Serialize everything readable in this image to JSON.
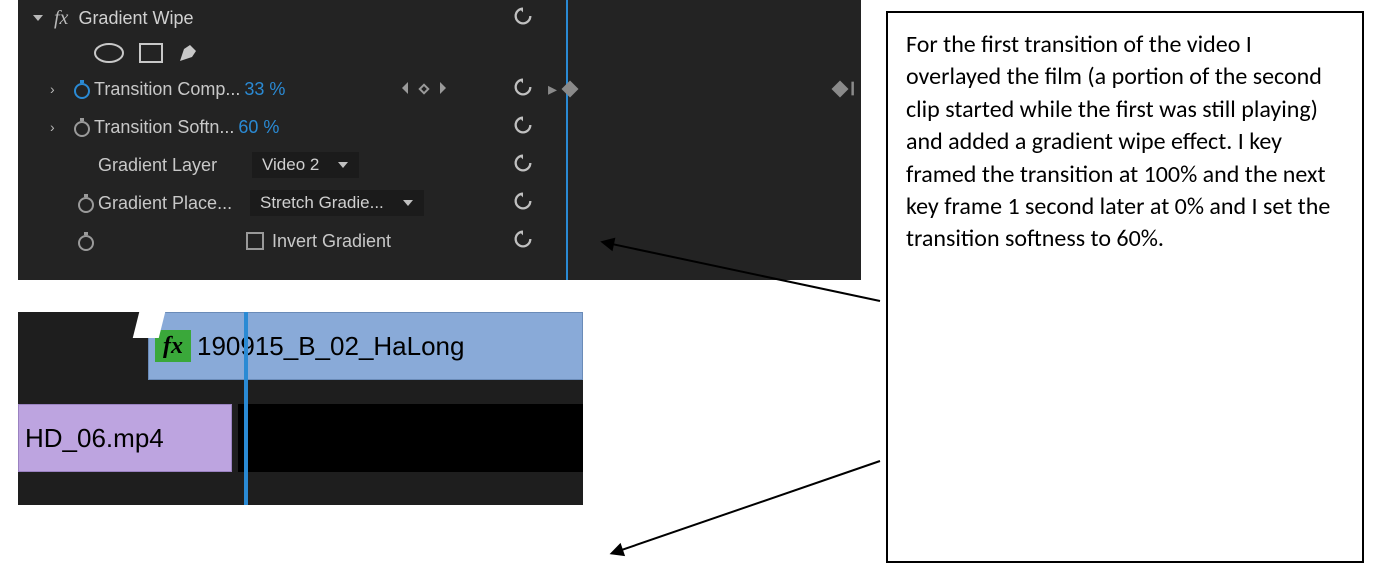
{
  "effects": {
    "name": "Gradient Wipe",
    "mask_shapes": [
      "ellipse",
      "rectangle",
      "pen"
    ],
    "props": {
      "transition_completion": {
        "label": "Transition Comp...",
        "value": "33 %",
        "animated": true
      },
      "transition_softness": {
        "label": "Transition Softn...",
        "value": "60 %",
        "animated": false
      },
      "gradient_layer": {
        "label": "Gradient Layer",
        "selected": "Video 2"
      },
      "gradient_placement": {
        "label": "Gradient Place...",
        "selected": "Stretch Gradie..."
      },
      "invert_gradient": {
        "label": "Invert Gradient",
        "checked": false
      }
    }
  },
  "timeline": {
    "clip_top": {
      "name": "190915_B_02_HaLong",
      "fx": true
    },
    "clip_bottom": {
      "name": "HD_06.mp4"
    }
  },
  "annotation": {
    "text": "For the first transition of the video I overlayed the film (a portion of the second clip started while the first was still playing) and added a gradient wipe effect. I key framed the transition at 100% and the next key frame 1 second later at 0% and I set the transition softness to 60%."
  }
}
